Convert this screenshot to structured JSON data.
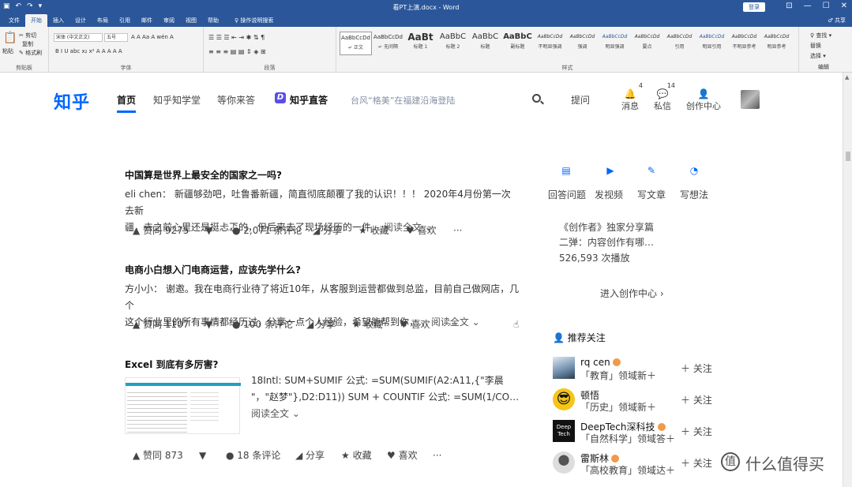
{
  "word": {
    "title": "看PT上演.docx - Word",
    "sign_in": "登录",
    "win_min": "—",
    "win_max": "☐",
    "win_close": "✕",
    "ribbon_opt": "⊡",
    "qa_save": "▣",
    "qa_undo": "↶",
    "qa_redo": "↷",
    "qa_more": "▾",
    "tabs": [
      "文件",
      "开始",
      "插入",
      "设计",
      "布局",
      "引用",
      "邮件",
      "审阅",
      "视图",
      "帮助",
      "♀ 操作说明搜索"
    ],
    "active_tab": "开始",
    "share": "♂ 共享",
    "clipboard": {
      "paste": "粘贴",
      "cut": "✂ 剪切",
      "copy": "复制",
      "format_painter": "✎ 格式刷",
      "label": "剪贴板"
    },
    "font": {
      "name": "宋体 (中文正文)",
      "size": "五号",
      "label": "字体",
      "row1": "A  A  Aa  A  wén  A",
      "row2": "B  I  U  abc  x₂  x²   A  A  A  A  A"
    },
    "paragraph": {
      "label": "段落",
      "row1": "☰  ☰  ☰  ⇤  ⇥  ✱  ⇅  ¶",
      "row2": "≡  ≡  ≡  ▤  ▤  ⇕  ◈  ⊞"
    },
    "styles": {
      "label": "样式",
      "items": [
        {
          "preview": "AaBbCcDd",
          "name": "↵ 正文"
        },
        {
          "preview": "AaBbCcDd",
          "name": "↵ 无间隔"
        },
        {
          "preview": "AaBt",
          "name": "标题 1"
        },
        {
          "preview": "AaBbC",
          "name": "标题 2"
        },
        {
          "preview": "AaBbC",
          "name": "标题"
        },
        {
          "preview": "AaBbC",
          "name": "副标题"
        },
        {
          "preview": "AaBbCcDd",
          "name": "不明显强调"
        },
        {
          "preview": "AaBbCcDd",
          "name": "强调"
        },
        {
          "preview": "AaBbCcDd",
          "name": "明显强调"
        },
        {
          "preview": "AaBbCcDd",
          "name": "要点"
        },
        {
          "preview": "AaBbCcDd",
          "name": "引用"
        },
        {
          "preview": "AaBbCcDd",
          "name": "明显引用"
        },
        {
          "preview": "AaBbCcDd",
          "name": "不明显参考"
        },
        {
          "preview": "AaBbCcDd",
          "name": "明显参考"
        }
      ]
    },
    "editing": {
      "find": "♀ 查找 ▾",
      "replace": "替换",
      "select": "选择 ▾",
      "label": "编辑"
    }
  },
  "zhihu": {
    "logo": "知乎",
    "nav": [
      "首页",
      "知乎知学堂",
      "等你来答",
      "知乎直答"
    ],
    "zhida_icon": "D",
    "search_placeholder": "台风“格美”在福建沿海登陆",
    "ask": "提问",
    "messages": {
      "label": "消息",
      "count": "4",
      "glyph": "🔔"
    },
    "inbox": {
      "label": "私信",
      "count": "14",
      "glyph": "💬"
    },
    "creator": {
      "label": "创作中心",
      "glyph": "👤"
    }
  },
  "feed": [
    {
      "title": "中国算是世界上最安全的国家之一吗?",
      "excerpt_l1": "eli chen：  新疆够劲吧，吐鲁番新疆，简直彻底颠覆了我的认识！！！ 2020年4月份第一次去新",
      "excerpt_l2": "疆，去之前心里还是挺忐忑的，但后来去了现场经历的一件…",
      "read_more": "阅读全文 ⌄",
      "upvote": "▲ 赞同 9275",
      "down": "▼",
      "comments": "● 2,071 条评论",
      "share": "◢ 分享",
      "fav": "★ 收藏",
      "like": "♥ 喜欢",
      "more": "···"
    },
    {
      "title": "电商小白想入门电商运营，应该先学什么?",
      "excerpt_l1": "方小小：  谢邀。我在电商行业待了将近10年，从客服到运营都做到总监，目前自己做网店，几个",
      "excerpt_l2": "这个行业里的所有事情都经历过，分享一点个人经验，希望能帮到你，…",
      "read_more": "阅读全文 ⌄",
      "upvote": "▲ 赞同 1107",
      "down": "▼",
      "comments": "● 100 条评论",
      "share": "◢ 分享",
      "fav": "★ 收藏",
      "like": "♥ 喜欢",
      "more": "···"
    },
    {
      "title": "Excel 到底有多厉害?",
      "excerpt_l1": "18Intl:  SUM+SUMIF 公式:  =SUM(SUMIF(A2:A11,{\"李晨",
      "excerpt_l2": "\"，\"赵梦\"},D2:D11)) SUM + COUNTIF 公式: =SUM(1/CO…",
      "read_more": "阅读全文 ⌄",
      "upvote": "▲ 赞同 873",
      "down": "▼",
      "comments": "● 18 条评论",
      "share": "◢ 分享",
      "fav": "★ 收藏",
      "like": "♥ 喜欢",
      "more": "···"
    }
  ],
  "sidebar": {
    "tools": [
      {
        "label": "回答问题",
        "glyph": "▤"
      },
      {
        "label": "发视频",
        "glyph": "▶"
      },
      {
        "label": "写文章",
        "glyph": "✎"
      },
      {
        "label": "写想法",
        "glyph": "◔"
      }
    ],
    "creator_title": "《创作者》独家分享篇",
    "creator_sub": "二弹：内容创作有哪…",
    "plays": "526,593 次播放",
    "enter_center": "进入创作中心 ›",
    "recommend_title": "推荐关注",
    "recommend_glyph": "👤",
    "users": [
      {
        "name": "rq cen",
        "desc": "「教育」领域新＋",
        "follow": "＋ 关注",
        "avatar_text": ""
      },
      {
        "name": "顿悟",
        "desc": "「历史」领域新＋",
        "follow": "＋ 关注",
        "avatar_text": "😎"
      },
      {
        "name": "DeepTech深科技",
        "desc": "「自然科学」领域答＋",
        "follow": "＋ 关注",
        "avatar_text": "Deep Tech"
      },
      {
        "name": "雷斯林",
        "desc": "「高校教育」领域达＋",
        "follow": "＋ 关注",
        "avatar_text": ""
      }
    ]
  },
  "watermark": {
    "logo": "值",
    "text": "什么值得买"
  },
  "colors": {
    "word_blue": "#2b579a",
    "zhihu_blue": "#0066ff"
  }
}
